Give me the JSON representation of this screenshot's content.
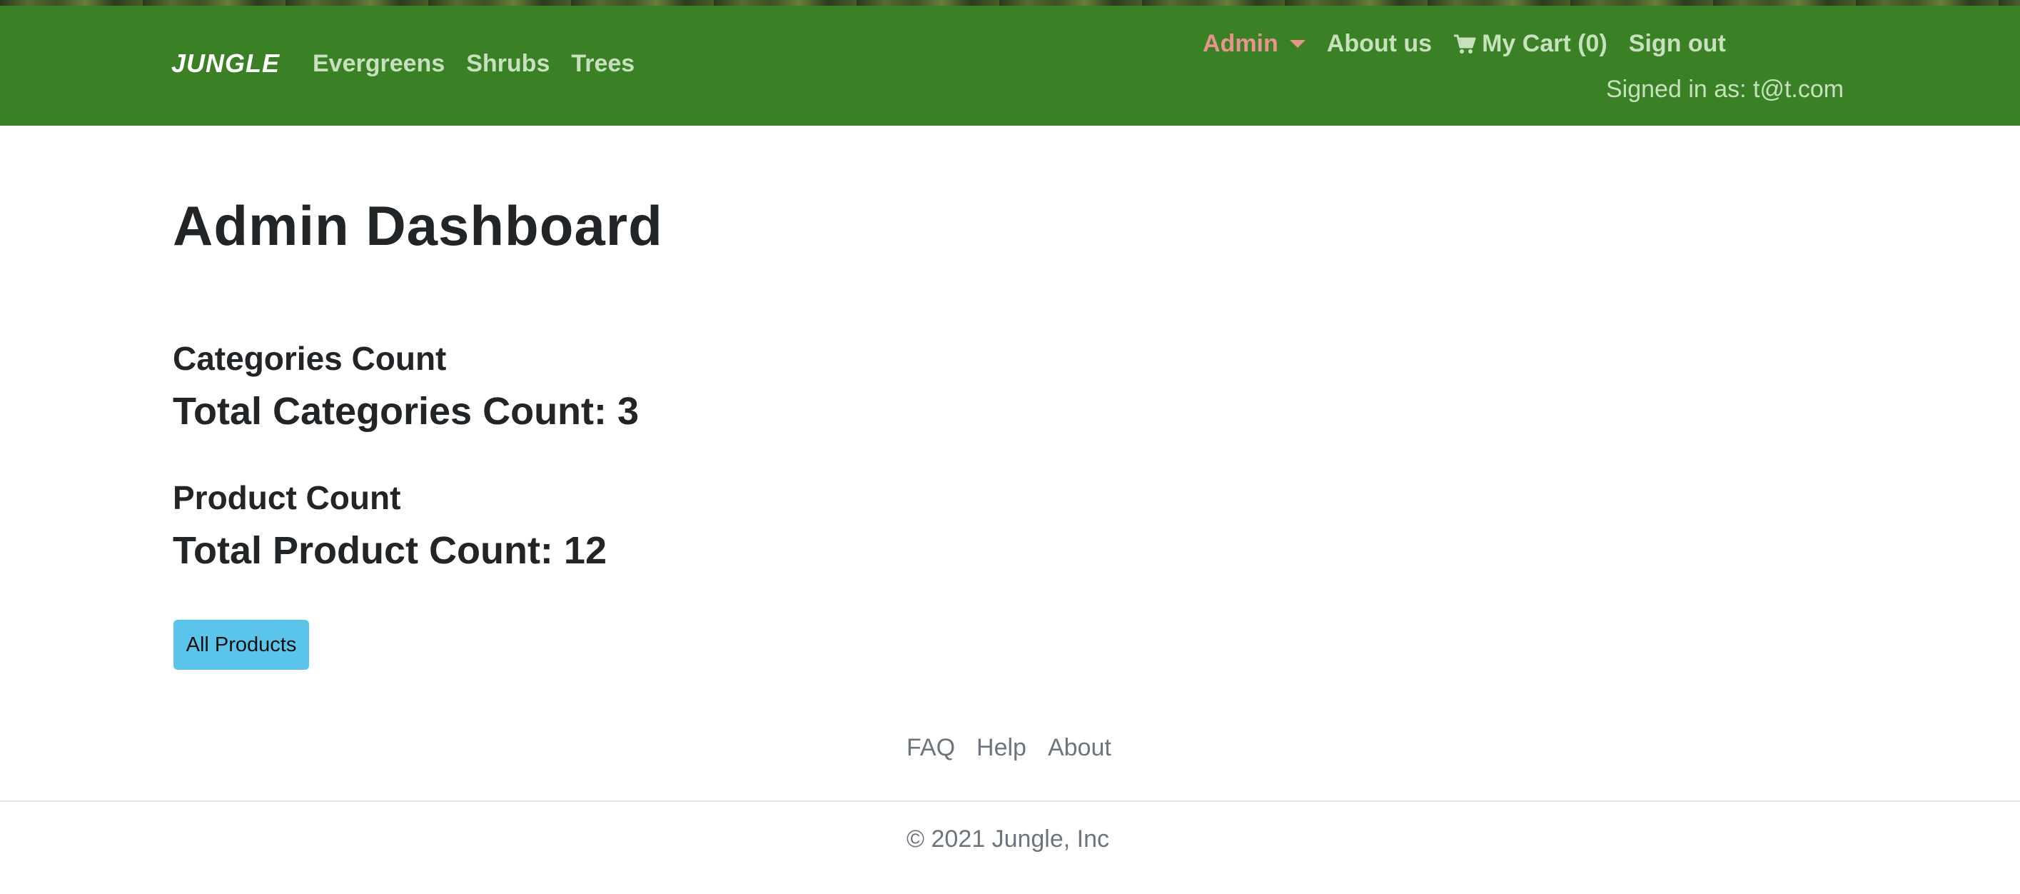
{
  "navbar": {
    "brand": "JUNGLE",
    "links": [
      "Evergreens",
      "Shrubs",
      "Trees"
    ],
    "admin_label": "Admin",
    "about_label": "About us",
    "cart_label": "My Cart (0)",
    "signout_label": "Sign out",
    "signed_in_text": "Signed in as: t@t.com",
    "icons": {
      "admin_dropdown": "caret-down-icon",
      "cart": "shopping-cart-icon"
    },
    "colors": {
      "background": "#3a8025",
      "link": "#c7e0bd",
      "admin_active": "#e8948e",
      "brand": "#ffffff"
    }
  },
  "main": {
    "title": "Admin Dashboard",
    "categories": {
      "label": "Categories Count",
      "value_text": "Total Categories Count: 3"
    },
    "products": {
      "label": "Product Count",
      "value_text": "Total Product Count: 12"
    },
    "all_products_button": "All Products",
    "button_color": "#5bc4eb"
  },
  "footer": {
    "links": [
      "FAQ",
      "Help",
      "About"
    ],
    "copyright": "© 2021 Jungle, Inc"
  }
}
